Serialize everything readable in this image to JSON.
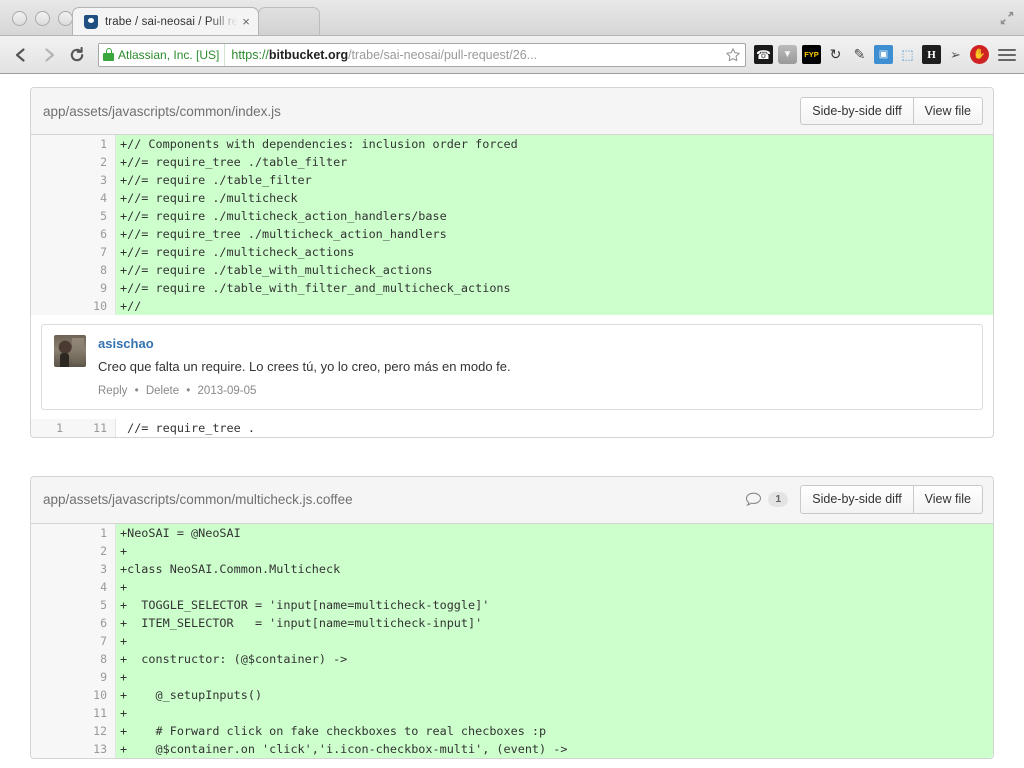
{
  "window": {
    "traffic_lights": [
      "close",
      "minimize",
      "zoom"
    ],
    "maximize_icon": "maximize-icon"
  },
  "tab": {
    "favicon": "bitbucket-favicon",
    "title": "trabe / sai-neosai / Pull re",
    "close_label": "×"
  },
  "toolbar": {
    "back_icon": "back-arrow-icon",
    "forward_icon": "forward-arrow-icon",
    "reload_icon": "reload-icon",
    "lock_icon": "lock-icon",
    "ev_certificate": "Atlassian, Inc. [US]",
    "url_scheme": "https",
    "url_separator": "://",
    "url_host": "bitbucket.org",
    "url_path": "/trabe/sai-neosai/pull-request/26...",
    "bookmark_icon": "star-icon",
    "extensions": [
      {
        "name": "phone-icon",
        "glyph": "☎",
        "bg": "#1a1a1a",
        "fg": "#ffffff"
      },
      {
        "name": "shield-chevron-icon",
        "glyph": "▼",
        "bg": "#9a9a9a",
        "fg": "#f0f0f0"
      },
      {
        "name": "fyp-icon",
        "glyph": "FYP",
        "bg": "#000000",
        "fg": "#ffcc00"
      },
      {
        "name": "refresh-clock-icon",
        "glyph": "↻",
        "bg": "transparent",
        "fg": "#333333"
      },
      {
        "name": "eyedropper-icon",
        "glyph": "✒",
        "bg": "transparent",
        "fg": "#555555"
      },
      {
        "name": "image-stack-icon",
        "glyph": "▣",
        "bg": "#3d8fd1",
        "fg": "#ffffff"
      },
      {
        "name": "screen-capture-icon",
        "glyph": "⬚",
        "bg": "transparent",
        "fg": "#3d8fd1"
      },
      {
        "name": "h-marker-icon",
        "glyph": "H",
        "bg": "#1f1f1f",
        "fg": "#ffffff"
      },
      {
        "name": "key-icon",
        "glyph": "⚔",
        "bg": "transparent",
        "fg": "#555555"
      },
      {
        "name": "adblock-stop-icon",
        "glyph": "✋",
        "bg": "#cf2222",
        "fg": "#ffffff"
      }
    ],
    "menu_icon": "hamburger-menu-icon"
  },
  "diffs": [
    {
      "path": "app/assets/javascripts/common/index.js",
      "comment_count": null,
      "buttons": [
        "Side-by-side diff",
        "View file"
      ],
      "lines": [
        {
          "kind": "added",
          "old": "",
          "new": "1",
          "text": "+// Components with dependencies: inclusion order forced"
        },
        {
          "kind": "added",
          "old": "",
          "new": "2",
          "text": "+//= require_tree ./table_filter"
        },
        {
          "kind": "added",
          "old": "",
          "new": "3",
          "text": "+//= require ./table_filter"
        },
        {
          "kind": "added",
          "old": "",
          "new": "4",
          "text": "+//= require ./multicheck"
        },
        {
          "kind": "added",
          "old": "",
          "new": "5",
          "text": "+//= require ./multicheck_action_handlers/base"
        },
        {
          "kind": "added",
          "old": "",
          "new": "6",
          "text": "+//= require_tree ./multicheck_action_handlers"
        },
        {
          "kind": "added",
          "old": "",
          "new": "7",
          "text": "+//= require ./multicheck_actions"
        },
        {
          "kind": "added",
          "old": "",
          "new": "8",
          "text": "+//= require ./table_with_multicheck_actions"
        },
        {
          "kind": "added",
          "old": "",
          "new": "9",
          "text": "+//= require ./table_with_filter_and_multicheck_actions"
        },
        {
          "kind": "added",
          "old": "",
          "new": "10",
          "text": "+//"
        },
        {
          "kind": "comment"
        },
        {
          "kind": "ctx",
          "old": "1",
          "new": "11",
          "text": " //= require_tree ."
        }
      ],
      "comment": {
        "avatar": "user-avatar",
        "author": "asischao",
        "text": "Creo que falta un require. Lo crees tú, yo lo creo, pero más en modo fe.",
        "reply_label": "Reply",
        "delete_label": "Delete",
        "date": "2013-09-05"
      }
    },
    {
      "path": "app/assets/javascripts/common/multicheck.js.coffee",
      "comment_count": "1",
      "comment_icon": "speech-bubble-icon",
      "buttons": [
        "Side-by-side diff",
        "View file"
      ],
      "lines": [
        {
          "kind": "added",
          "old": "",
          "new": "1",
          "text": "+NeoSAI = @NeoSAI"
        },
        {
          "kind": "added",
          "old": "",
          "new": "2",
          "text": "+"
        },
        {
          "kind": "added",
          "old": "",
          "new": "3",
          "text": "+class NeoSAI.Common.Multicheck"
        },
        {
          "kind": "added",
          "old": "",
          "new": "4",
          "text": "+"
        },
        {
          "kind": "added",
          "old": "",
          "new": "5",
          "text": "+  TOGGLE_SELECTOR = 'input[name=multicheck-toggle]'"
        },
        {
          "kind": "added",
          "old": "",
          "new": "6",
          "text": "+  ITEM_SELECTOR   = 'input[name=multicheck-input]'"
        },
        {
          "kind": "added",
          "old": "",
          "new": "7",
          "text": "+"
        },
        {
          "kind": "added",
          "old": "",
          "new": "8",
          "text": "+  constructor: (@$container) ->"
        },
        {
          "kind": "added",
          "old": "",
          "new": "9",
          "text": "+"
        },
        {
          "kind": "added",
          "old": "",
          "new": "10",
          "text": "+    @_setupInputs()"
        },
        {
          "kind": "added",
          "old": "",
          "new": "11",
          "text": "+"
        },
        {
          "kind": "added",
          "old": "",
          "new": "12",
          "text": "+    # Forward click on fake checkboxes to real checboxes :p"
        },
        {
          "kind": "added",
          "old": "",
          "new": "13",
          "text": "+    @$container.on 'click','i.icon-checkbox-multi', (event) ->"
        }
      ]
    }
  ],
  "colors": {
    "added_bg": "#ccffcc",
    "gutter_bg": "#f7f7f7",
    "header_bg": "#f5f5f5",
    "link": "#3572b0",
    "ev_green": "#2e8b2e",
    "page_bg": "#ffffff"
  }
}
